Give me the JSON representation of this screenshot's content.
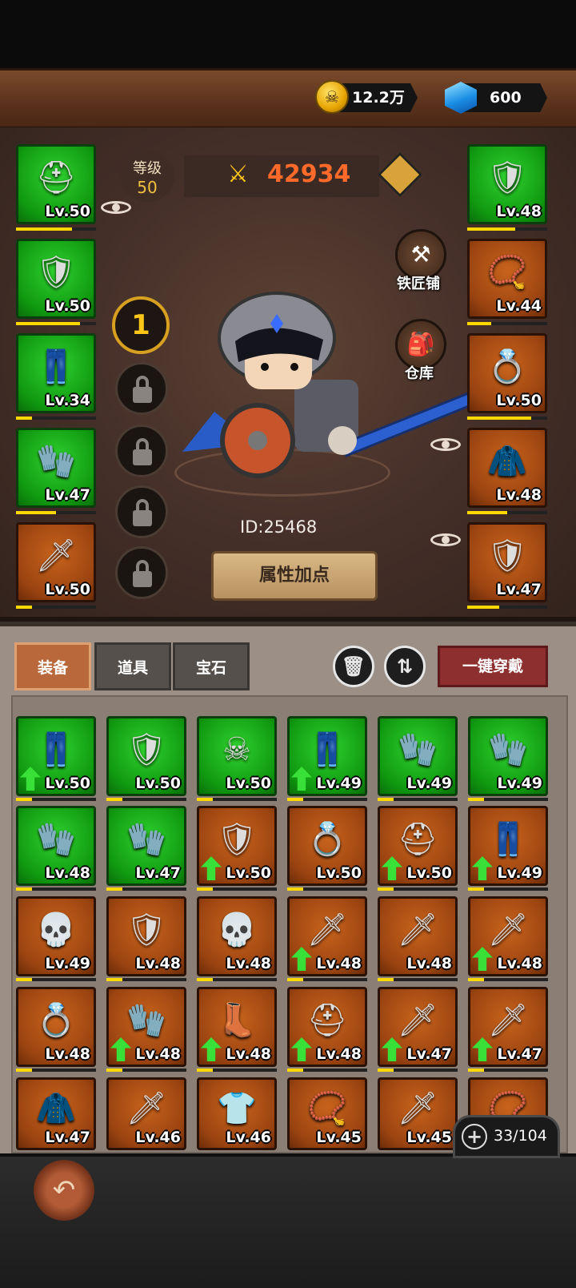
{
  "currency": {
    "gold": "12.2万",
    "gems": "600",
    "gold_icon": "skull-coin-icon",
    "gem_icon": "diamond-icon"
  },
  "player": {
    "level_label": "等级",
    "level_value": "50",
    "power": "42934",
    "id_text": "ID:25468",
    "stats_button": "属性加点",
    "skill_slot_number": "1"
  },
  "shortcuts": {
    "blacksmith": "铁匠铺",
    "warehouse": "仓库"
  },
  "equipped_left": [
    {
      "level": "Lv.50",
      "rarity": "green",
      "icon": "helmet-icon",
      "xp": 0.7
    },
    {
      "level": "Lv.50",
      "rarity": "green",
      "icon": "armor-icon",
      "xp": 0.8
    },
    {
      "level": "Lv.34",
      "rarity": "green",
      "icon": "pants-icon",
      "xp": 0.2
    },
    {
      "level": "Lv.47",
      "rarity": "green",
      "icon": "gauntlet-icon",
      "xp": 0.5
    },
    {
      "level": "Lv.50",
      "rarity": "orange",
      "icon": "sword-icon",
      "xp": 0.2
    }
  ],
  "equipped_right": [
    {
      "level": "Lv.48",
      "rarity": "green",
      "icon": "shoulder-icon",
      "xp": 0.6
    },
    {
      "level": "Lv.44",
      "rarity": "orange",
      "icon": "amulet-icon",
      "xp": 0.3
    },
    {
      "level": "Lv.50",
      "rarity": "orange",
      "icon": "ring-icon",
      "xp": 0.8
    },
    {
      "level": "Lv.48",
      "rarity": "orange",
      "icon": "cape-icon",
      "xp": 0.5
    },
    {
      "level": "Lv.47",
      "rarity": "orange",
      "icon": "shield-icon",
      "xp": 0.4
    }
  ],
  "tabs": [
    "装备",
    "道具",
    "宝石"
  ],
  "equip_all_button": "一键穿戴",
  "capacity": "33/104",
  "inventory": [
    {
      "level": "Lv.50",
      "rarity": "green",
      "icon": "pants-icon",
      "upgrade": true
    },
    {
      "level": "Lv.50",
      "rarity": "green",
      "icon": "armor-icon",
      "upgrade": false
    },
    {
      "level": "Lv.50",
      "rarity": "green",
      "icon": "skull-armor-icon",
      "upgrade": false
    },
    {
      "level": "Lv.49",
      "rarity": "green",
      "icon": "pants-icon",
      "upgrade": true
    },
    {
      "level": "Lv.49",
      "rarity": "green",
      "icon": "gauntlet-icon",
      "upgrade": false
    },
    {
      "level": "Lv.49",
      "rarity": "green",
      "icon": "gauntlet-icon",
      "upgrade": false
    },
    {
      "level": "Lv.48",
      "rarity": "green",
      "icon": "gauntlet-icon",
      "upgrade": false
    },
    {
      "level": "Lv.47",
      "rarity": "green",
      "icon": "gauntlet-icon",
      "upgrade": false
    },
    {
      "level": "Lv.50",
      "rarity": "orange",
      "icon": "shield-icon",
      "upgrade": true
    },
    {
      "level": "Lv.50",
      "rarity": "orange",
      "icon": "ring-icon",
      "upgrade": false
    },
    {
      "level": "Lv.50",
      "rarity": "orange",
      "icon": "horned-helmet-icon",
      "upgrade": true
    },
    {
      "level": "Lv.49",
      "rarity": "orange",
      "icon": "pants-icon",
      "upgrade": true
    },
    {
      "level": "Lv.49",
      "rarity": "orange",
      "icon": "skull-ring-icon",
      "upgrade": false
    },
    {
      "level": "Lv.48",
      "rarity": "orange",
      "icon": "shield-icon",
      "upgrade": false
    },
    {
      "level": "Lv.48",
      "rarity": "orange",
      "icon": "skull-shield-icon",
      "upgrade": false
    },
    {
      "level": "Lv.48",
      "rarity": "orange",
      "icon": "sword-icon",
      "upgrade": true
    },
    {
      "level": "Lv.48",
      "rarity": "orange",
      "icon": "sword-icon",
      "upgrade": false
    },
    {
      "level": "Lv.48",
      "rarity": "orange",
      "icon": "sword-icon",
      "upgrade": true
    },
    {
      "level": "Lv.48",
      "rarity": "orange",
      "icon": "ring-icon",
      "upgrade": false
    },
    {
      "level": "Lv.48",
      "rarity": "orange",
      "icon": "bracer-icon",
      "upgrade": true
    },
    {
      "level": "Lv.48",
      "rarity": "orange",
      "icon": "boots-icon",
      "upgrade": true
    },
    {
      "level": "Lv.48",
      "rarity": "orange",
      "icon": "spiked-helmet-icon",
      "upgrade": true
    },
    {
      "level": "Lv.47",
      "rarity": "orange",
      "icon": "sword-icon",
      "upgrade": true
    },
    {
      "level": "Lv.47",
      "rarity": "orange",
      "icon": "sword-icon",
      "upgrade": true
    },
    {
      "level": "Lv.47",
      "rarity": "orange",
      "icon": "cape-icon",
      "upgrade": false
    },
    {
      "level": "Lv.46",
      "rarity": "orange",
      "icon": "sword-icon",
      "upgrade": false
    },
    {
      "level": "Lv.46",
      "rarity": "orange",
      "icon": "tunic-icon",
      "upgrade": false
    },
    {
      "level": "Lv.45",
      "rarity": "orange",
      "icon": "amulet-icon",
      "upgrade": false
    },
    {
      "level": "Lv.45",
      "rarity": "orange",
      "icon": "sword-icon",
      "upgrade": false
    },
    {
      "level": "",
      "rarity": "orange",
      "icon": "amulet-icon",
      "upgrade": false
    }
  ],
  "colors": {
    "green_rarity": "#13a313",
    "orange_rarity": "#a34a12",
    "power": "#ff6a2a",
    "equip_all": "#8d2f2f"
  }
}
